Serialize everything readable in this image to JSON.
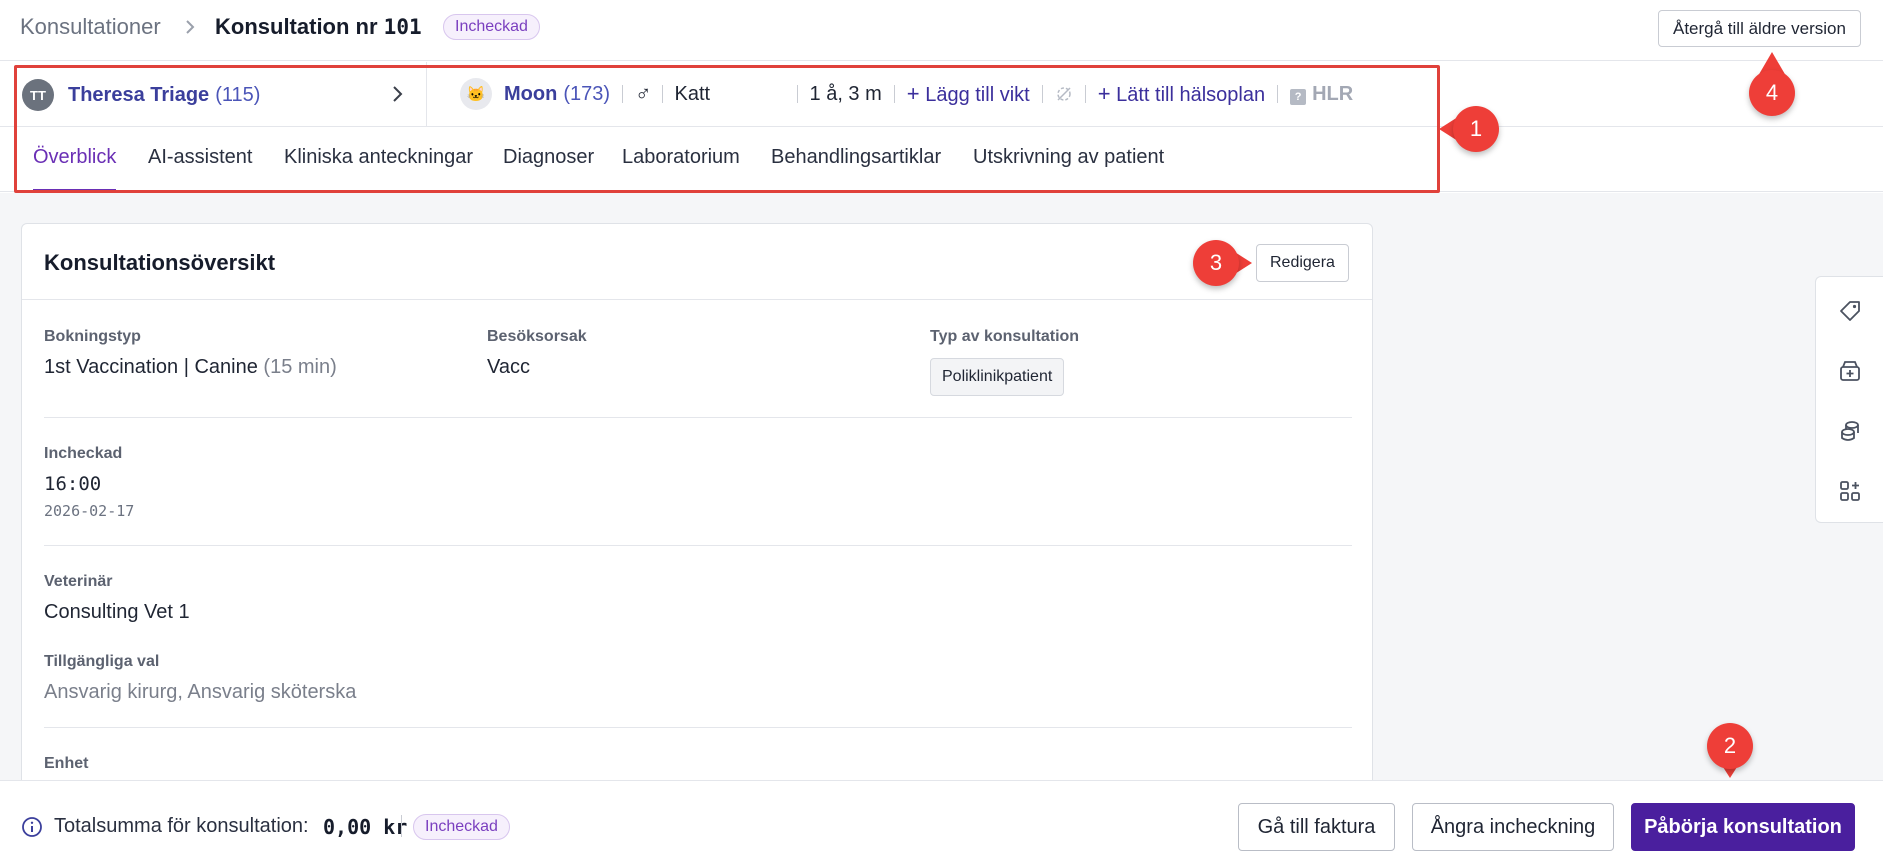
{
  "header": {
    "breadcrumb_root": "Konsultationer",
    "title_prefix": "Konsultation nr",
    "title_number": "101",
    "status": "Incheckad",
    "older_version_button": "Återgå till äldre version"
  },
  "patient_bar": {
    "owner_initials": "TT",
    "owner_name": "Theresa Triage",
    "owner_id": "(115)",
    "pet_name": "Moon",
    "pet_id": "(173)",
    "sex_symbol": "♂",
    "species": "Katt",
    "age": "1 å, 3 m",
    "add_weight": "Lägg till vikt",
    "add_health_plan": "Lätt till hälsoplan",
    "hlr_label": "HLR",
    "hlr_badge": "?"
  },
  "tabs": [
    {
      "label": "Överblick",
      "active": true
    },
    {
      "label": "AI-assistent",
      "active": false
    },
    {
      "label": "Kliniska anteckningar",
      "active": false
    },
    {
      "label": "Diagnoser",
      "active": false
    },
    {
      "label": "Laboratorium",
      "active": false
    },
    {
      "label": "Behandlingsartiklar",
      "active": false
    },
    {
      "label": "Utskrivning av patient",
      "active": false
    }
  ],
  "overview": {
    "title": "Konsultationsöversikt",
    "edit_button": "Redigera",
    "booking_type_label": "Bokningstyp",
    "booking_type_value": "1st Vaccination | Canine",
    "booking_type_duration": "(15 min)",
    "visit_reason_label": "Besöksorsak",
    "visit_reason_value": "Vacc",
    "consultation_type_label": "Typ av konsultation",
    "consultation_type_value": "Poliklinikpatient",
    "checked_in_label": "Incheckad",
    "checked_in_time": "16:00",
    "checked_in_date": "2026-02-17",
    "vet_label": "Veterinär",
    "vet_value": "Consulting Vet 1",
    "available_options_label": "Tillgängliga val",
    "available_options_value": "Ansvarig kirurg, Ansvarig sköterska",
    "unit_label": "Enhet"
  },
  "side_panel": {
    "icons": [
      "tag-icon",
      "archive-add-icon",
      "coins-icon",
      "add-widget-icon"
    ]
  },
  "footer": {
    "total_label": "Totalsumma för konsultation:",
    "total_amount": "0,00 kr",
    "status": "Incheckad",
    "invoice_button": "Gå till faktura",
    "undo_checkin_button": "Ångra incheckning",
    "start_button": "Påbörja konsultation"
  },
  "annotations": {
    "marker_1": "1",
    "marker_2": "2",
    "marker_3": "3",
    "marker_4": "4",
    "color": "#ee3e38"
  },
  "colors": {
    "accent": "#6a2fb5",
    "primary_button": "#4a1f9e",
    "link": "#3b3f9c"
  }
}
